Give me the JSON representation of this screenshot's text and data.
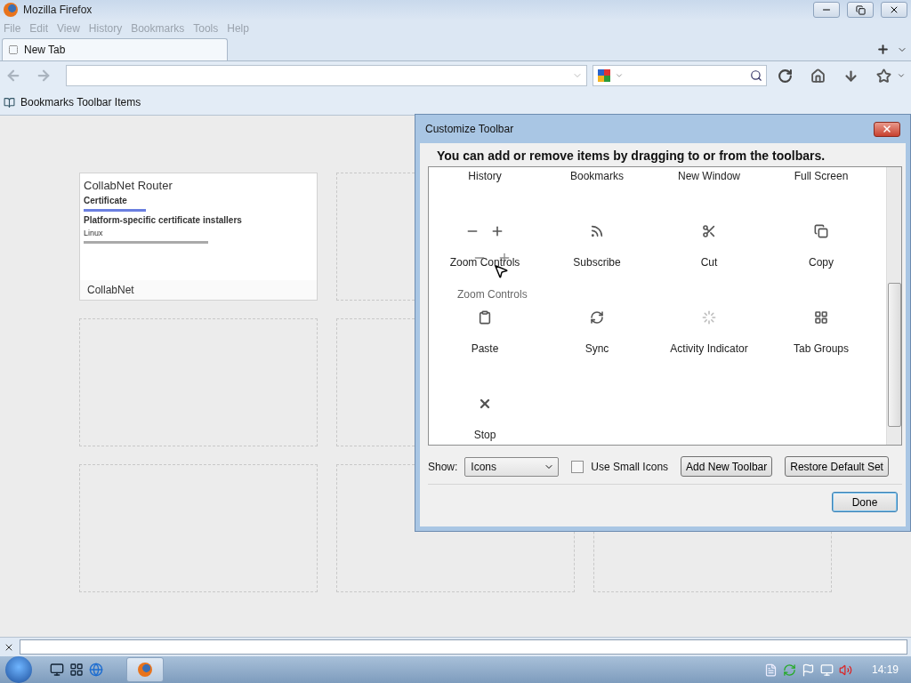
{
  "window": {
    "title": "Mozilla Firefox"
  },
  "menu": [
    {
      "label": "File",
      "disabled": true
    },
    {
      "label": "Edit",
      "disabled": true
    },
    {
      "label": "View",
      "disabled": true
    },
    {
      "label": "History",
      "disabled": true
    },
    {
      "label": "Bookmarks",
      "disabled": true
    },
    {
      "label": "Tools",
      "disabled": true
    },
    {
      "label": "Help",
      "disabled": true
    }
  ],
  "tabs": [
    {
      "label": "New Tab",
      "selected": true
    }
  ],
  "bookmarks_toolbar": {
    "label": "Bookmarks Toolbar Items"
  },
  "thumbnail_rows": [
    [
      {
        "kind": "page",
        "title": "CollabNet",
        "page_heading": "CollabNet Router",
        "lines": [
          "Certificate",
          "Platform-specific certificate installers",
          "Linux"
        ]
      },
      {
        "kind": "empty"
      }
    ],
    [
      {
        "kind": "empty"
      },
      {
        "kind": "empty"
      }
    ],
    [
      {
        "kind": "empty"
      },
      {
        "kind": "empty"
      },
      {
        "kind": "empty"
      }
    ]
  ],
  "dialog": {
    "title": "Customize Toolbar",
    "instruction": "You can add or remove items by dragging to or from the toolbars.",
    "items": [
      {
        "kind": "cut-off",
        "label": "History"
      },
      {
        "kind": "cut-off",
        "label": "Bookmarks"
      },
      {
        "kind": "cut-off",
        "label": "New Window"
      },
      {
        "kind": "cut-off",
        "label": "Full Screen"
      },
      {
        "kind": "zoom",
        "label": "Zoom Controls"
      },
      {
        "kind": "feed",
        "label": "Subscribe"
      },
      {
        "kind": "cut",
        "label": "Cut"
      },
      {
        "kind": "copy",
        "label": "Copy"
      },
      {
        "kind": "paste",
        "label": "Paste"
      },
      {
        "kind": "sync",
        "label": "Sync"
      },
      {
        "kind": "activity",
        "label": "Activity Indicator"
      },
      {
        "kind": "tabgroups",
        "label": "Tab Groups"
      },
      {
        "kind": "stop",
        "label": "Stop"
      }
    ],
    "drag_ghost": {
      "label": "Zoom Controls"
    },
    "show_label": "Show:",
    "show_value": "Icons",
    "small_icons": {
      "label": "Use Small Icons",
      "checked": false
    },
    "buttons": [
      "Add New Toolbar",
      "Restore Default Set"
    ],
    "done": "Done"
  },
  "taskbar": {
    "clock": "14:19"
  }
}
